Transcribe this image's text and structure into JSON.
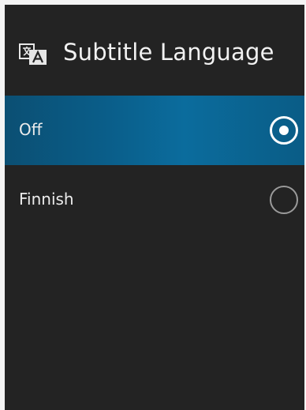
{
  "header": {
    "icon": "translate-icon",
    "title": "Subtitle Language"
  },
  "options": [
    {
      "label": "Off",
      "selected": true
    },
    {
      "label": "Finnish",
      "selected": false
    }
  ],
  "colors": {
    "panel_background": "#232323",
    "selection_accent": "#0a5e8a",
    "text": "#f2f2f2"
  }
}
